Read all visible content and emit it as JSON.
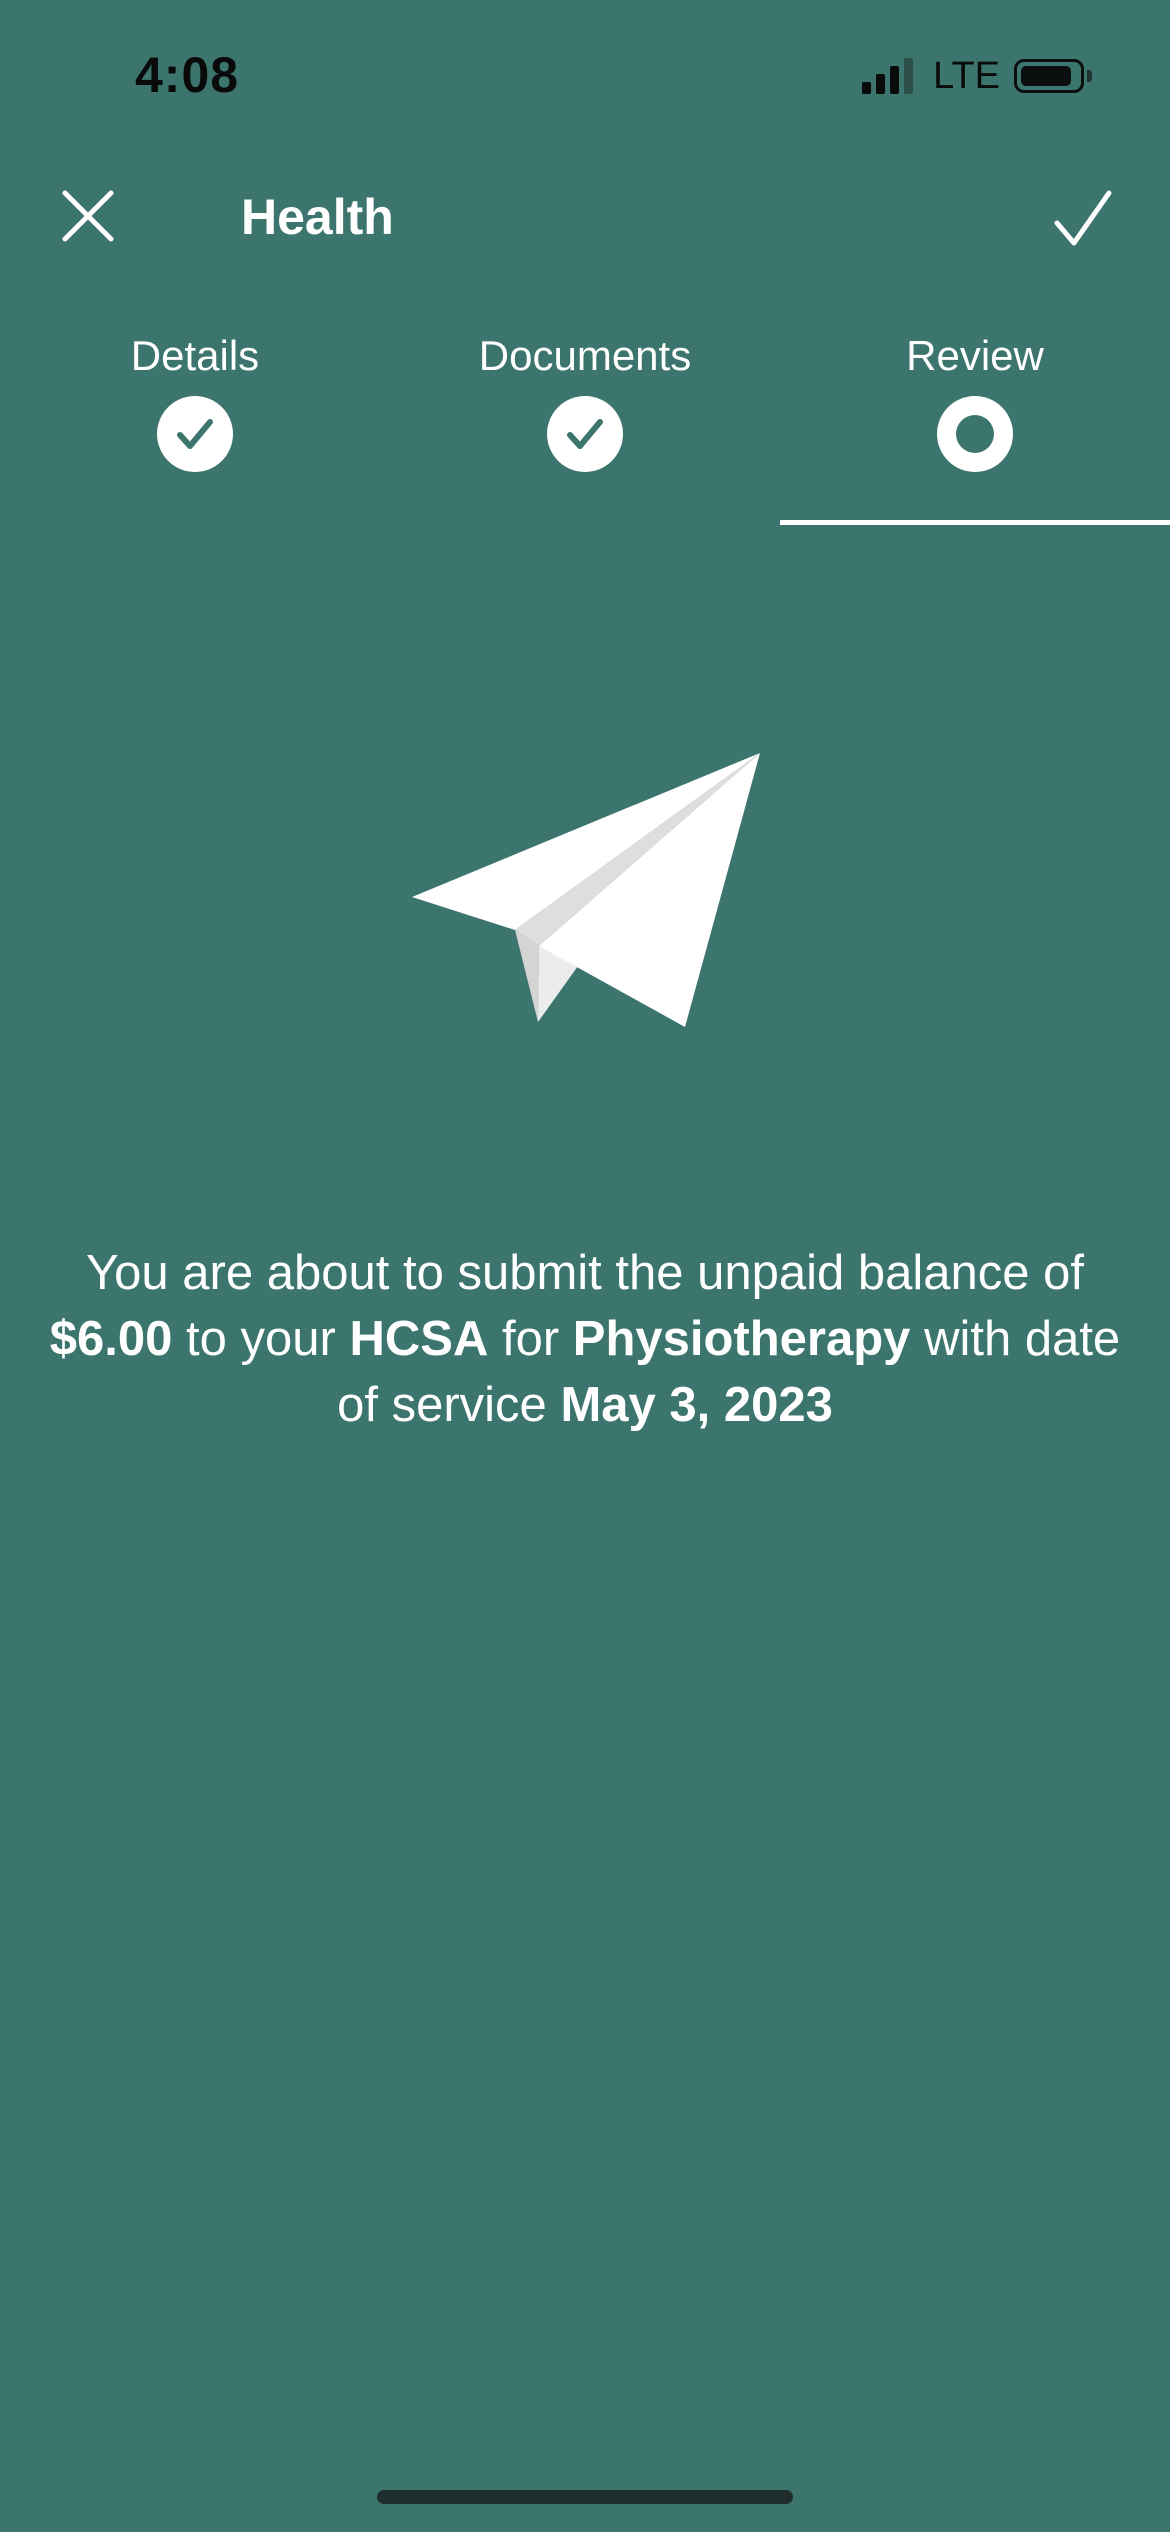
{
  "status_bar": {
    "time": "4:08",
    "network": "LTE"
  },
  "nav": {
    "title": "Health",
    "close_icon": "close-icon",
    "confirm_icon": "checkmark-icon"
  },
  "steps": [
    {
      "label": "Details",
      "state": "complete",
      "icon": "check-circle-icon"
    },
    {
      "label": "Documents",
      "state": "complete",
      "icon": "check-circle-icon"
    },
    {
      "label": "Review",
      "state": "current",
      "icon": "ring-icon"
    }
  ],
  "illustration": {
    "icon": "paper-plane-icon"
  },
  "message": {
    "part1": "You are about to submit the unpaid balance of",
    "amount": "$6.00",
    "part2": "to your",
    "account": "HCSA",
    "part3": "for",
    "category": "Physiotherapy",
    "part4": "with date of service",
    "date": "May 3, 2023"
  },
  "colors": {
    "background": "#3c756d",
    "foreground": "#ffffff",
    "status_text": "#0a0a0a"
  }
}
